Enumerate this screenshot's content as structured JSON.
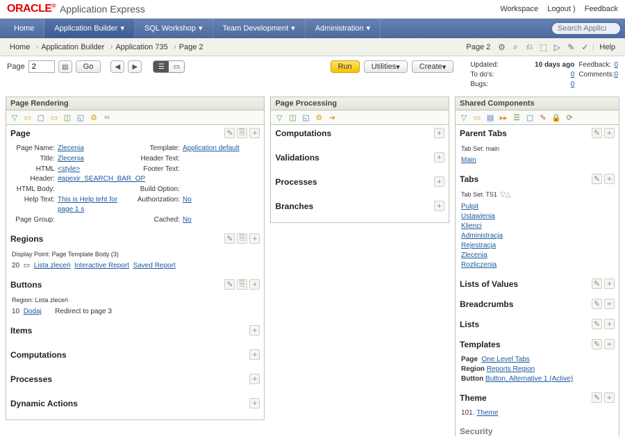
{
  "header": {
    "logo": "ORACLE",
    "title": "Application Express",
    "workspace": "Workspace",
    "logout": "Logout",
    "feedback": "Feedback"
  },
  "nav": {
    "home": "Home",
    "app_builder": "Application Builder",
    "sql": "SQL Workshop",
    "team": "Team Development",
    "admin": "Administration",
    "search_placeholder": "Search Application"
  },
  "crumb": {
    "home": "Home",
    "app_builder": "Application Builder",
    "app": "Application 735",
    "page": "Page 2",
    "indicator": "Page 2",
    "help": "Help"
  },
  "controls": {
    "page_label": "Page",
    "page_value": "2",
    "go": "Go",
    "run": "Run",
    "utilities": "Utilities",
    "create": "Create"
  },
  "meta": {
    "updated_label": "Updated:",
    "updated_value": "10 days ago",
    "todos_label": "To do's:",
    "todos_value": "0",
    "feedback_label": "Feedback:",
    "feedback_value": "0",
    "bugs_label": "Bugs:",
    "bugs_value": "0",
    "comments_label": "Comments:",
    "comments_value": "0"
  },
  "cols": {
    "left": "Page Rendering",
    "mid": "Page Processing",
    "right": "Shared Components"
  },
  "page_section": {
    "title": "Page",
    "page_name_k": "Page Name:",
    "page_name_v": "Zlecenia",
    "title_k": "Title:",
    "title_v": "Zlecenia",
    "html_header_k": "HTML Header:",
    "html_header_v": "<style> #apexir_SEARCH_BAR_OP",
    "html_body_k": "HTML Body:",
    "help_text_k": "Help Text:",
    "help_text_v": "This is Help teht for page 1 s",
    "page_group_k": "Page Group:",
    "template_k": "Template:",
    "template_v": "Application default",
    "header_text_k": "Header Text:",
    "footer_text_k": "Footer Text:",
    "build_option_k": "Build Option:",
    "authorization_k": "Authorization:",
    "authorization_v": "No",
    "cached_k": "Cached:",
    "cached_v": "No"
  },
  "regions": {
    "title": "Regions",
    "dp": "Display Point: Page Template Body (3)",
    "count": "20",
    "lista": "Lista zleceń",
    "ir": "Interactive Report",
    "sr": "Saved Report"
  },
  "buttons": {
    "title": "Buttons",
    "region": "Region: Lista zleceń",
    "num": "10",
    "dodaj": "Dodaj",
    "redirect": "Redirect to page 3"
  },
  "items": {
    "title": "Items"
  },
  "comps": {
    "title": "Computations"
  },
  "procs": {
    "title": "Processes"
  },
  "dyn": {
    "title": "Dynamic Actions"
  },
  "pp": {
    "comps": "Computations",
    "vals": "Validations",
    "procs": "Processes",
    "branches": "Branches"
  },
  "shared": {
    "parent_tabs": "Parent Tabs",
    "tabset_main_k": "Tab Set: main",
    "main_link": "Main",
    "tabs": "Tabs",
    "tabset_ts1": "Tab Set: TS1",
    "tab_links": [
      "Pulpit",
      "Ustawienia",
      "Klienci",
      "Administracja",
      "Rejestracja",
      "Zlecenia",
      "Rozliczenia"
    ],
    "lov": "Lists of Values",
    "breadcrumbs": "Breadcrumbs",
    "lists": "Lists",
    "templates": "Templates",
    "tpl_page_k": "Page",
    "tpl_page_v": "One Level Tabs",
    "tpl_region_k": "Region",
    "tpl_region_v": "Reports Region",
    "tpl_button_k": "Button",
    "tpl_button_v": "Button, Alternative 1 (Active)",
    "theme": "Theme",
    "theme_num": "101.",
    "theme_link": "Theme",
    "security": "Security"
  }
}
